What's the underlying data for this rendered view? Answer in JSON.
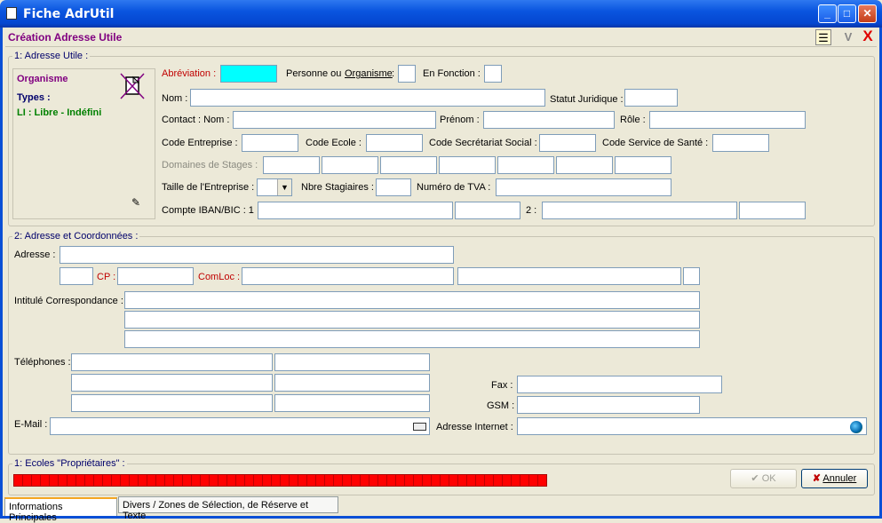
{
  "window": {
    "title": "Fiche AdrUtil",
    "subtitle": "Création Adresse Utile"
  },
  "section1": {
    "title": "1: Adresse Utile :",
    "side": {
      "heading": "Organisme",
      "types_label": "Types :",
      "type_value": "LI   : Libre - Indéfini"
    },
    "labels": {
      "abreviation": "Abréviation :",
      "personne_ou": "Personne ou",
      "organisme": "Organisme",
      "colon": ":",
      "en_fonction": "En Fonction :",
      "nom": "Nom :",
      "statut": "Statut Juridique :",
      "contact": "Contact :  Nom :",
      "prenom": "Prénom :",
      "role": "Rôle :",
      "code_entreprise": "Code Entreprise :",
      "code_ecole": "Code Ecole :",
      "code_secretariat": "Code Secrétariat Social :",
      "code_sante": "Code Service de Santé :",
      "domaines": "Domaines de Stages :",
      "taille": "Taille de l'Entreprise :",
      "nbre": "Nbre Stagiaires :",
      "tva": "Numéro de TVA :",
      "iban": "Compte IBAN/BIC : 1 :",
      "iban2": "2 :"
    }
  },
  "section2": {
    "title": "2: Adresse et Coordonnées :",
    "labels": {
      "adresse": "Adresse :",
      "cp": "CP :",
      "comloc": "ComLoc :",
      "intitule": "Intitulé Correspondance :",
      "telephones": "Téléphones :",
      "fax": "Fax :",
      "gsm": "GSM :",
      "email": "E-Mail :",
      "internet": "Adresse Internet :"
    }
  },
  "section3": {
    "title": "1: Ecoles \"Propriétaires\" :"
  },
  "buttons": {
    "ok": "OK",
    "annuler": "Annuler"
  },
  "tabs": [
    "Informations Principales",
    "Divers / Zones de Sélection, de Réserve et Texte"
  ],
  "colors": {
    "titlebar": "#0a55df",
    "subtitle": "#800080",
    "required": "#c00000",
    "highlight": "#00ffff",
    "progress": "#ff0000"
  }
}
